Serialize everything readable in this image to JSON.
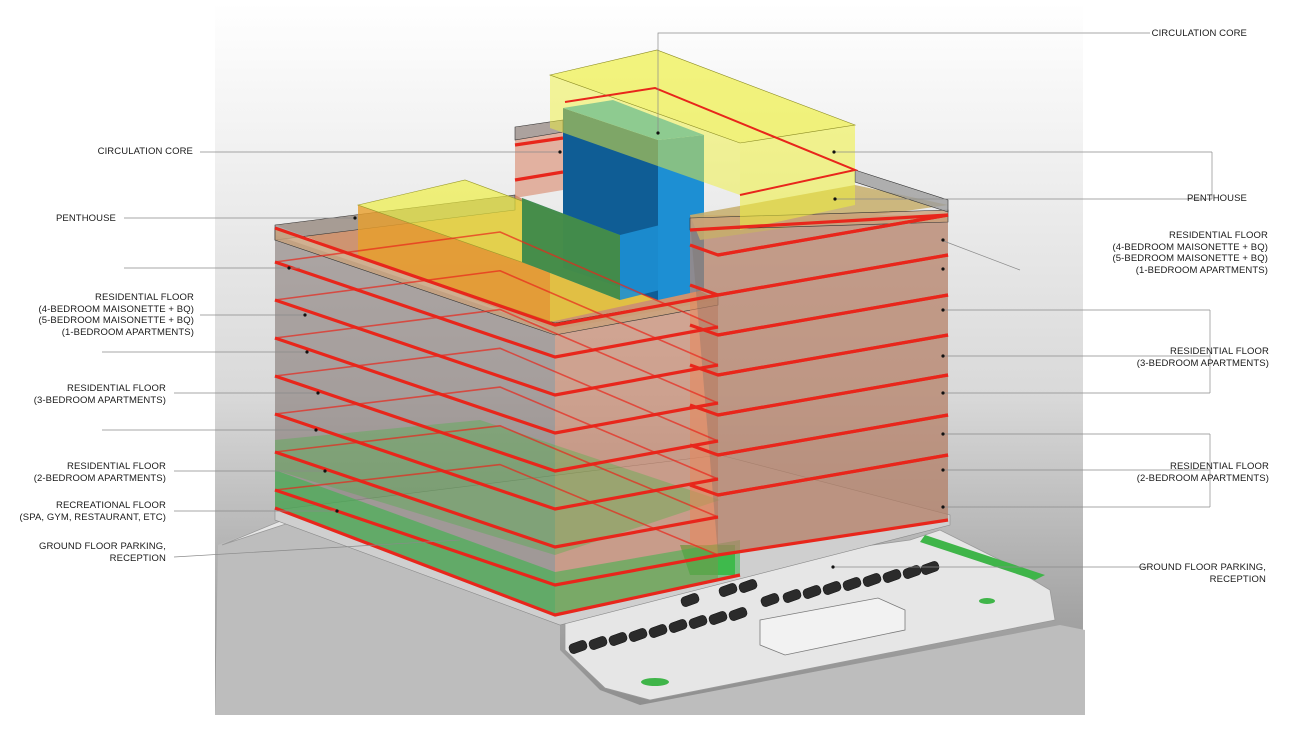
{
  "colors": {
    "floor_edge": "#e8261b",
    "residential_fill": "#e9875a",
    "recreational_fill": "#39b54a",
    "penthouse_fill": "#e6ef2a",
    "core_fill": "#1d8fd3",
    "background_top": "#ffffff",
    "background_bottom": "#8c8c8c",
    "leader_line": "#888888"
  },
  "labels": {
    "left": [
      {
        "id": "circulation-core",
        "lines": [
          "CIRCULATION CORE"
        ]
      },
      {
        "id": "penthouse",
        "lines": [
          "PENTHOUSE"
        ]
      },
      {
        "id": "residential-maisonette",
        "lines": [
          "RESIDENTIAL FLOOR",
          "(4-BEDROOM MAISONETTE + BQ)",
          "(5-BEDROOM MAISONETTE + BQ)",
          "(1-BEDROOM APARTMENTS)"
        ]
      },
      {
        "id": "residential-3bed",
        "lines": [
          "RESIDENTIAL FLOOR",
          "(3-BEDROOM APARTMENTS)"
        ]
      },
      {
        "id": "residential-2bed",
        "lines": [
          "RESIDENTIAL FLOOR",
          "(2-BEDROOM APARTMENTS)"
        ]
      },
      {
        "id": "recreational",
        "lines": [
          "RECREATIONAL FLOOR",
          "(SPA, GYM, RESTAURANT, ETC)"
        ]
      },
      {
        "id": "ground-floor",
        "lines": [
          "GROUND FLOOR PARKING,",
          "RECEPTION"
        ]
      }
    ],
    "right": [
      {
        "id": "circulation-core",
        "lines": [
          "CIRCULATION CORE"
        ]
      },
      {
        "id": "penthouse",
        "lines": [
          "PENTHOUSE"
        ]
      },
      {
        "id": "residential-maisonette",
        "lines": [
          "RESIDENTIAL FLOOR",
          "(4-BEDROOM MAISONETTE + BQ)",
          "(5-BEDROOM MAISONETTE + BQ)",
          "(1-BEDROOM APARTMENTS)"
        ]
      },
      {
        "id": "residential-3bed",
        "lines": [
          "RESIDENTIAL FLOOR",
          "(3-BEDROOM APARTMENTS)"
        ]
      },
      {
        "id": "residential-2bed",
        "lines": [
          "RESIDENTIAL FLOOR",
          "(2-BEDROOM APARTMENTS)"
        ]
      },
      {
        "id": "ground-floor",
        "lines": [
          "GROUND FLOOR PARKING,",
          "RECEPTION"
        ]
      }
    ]
  }
}
